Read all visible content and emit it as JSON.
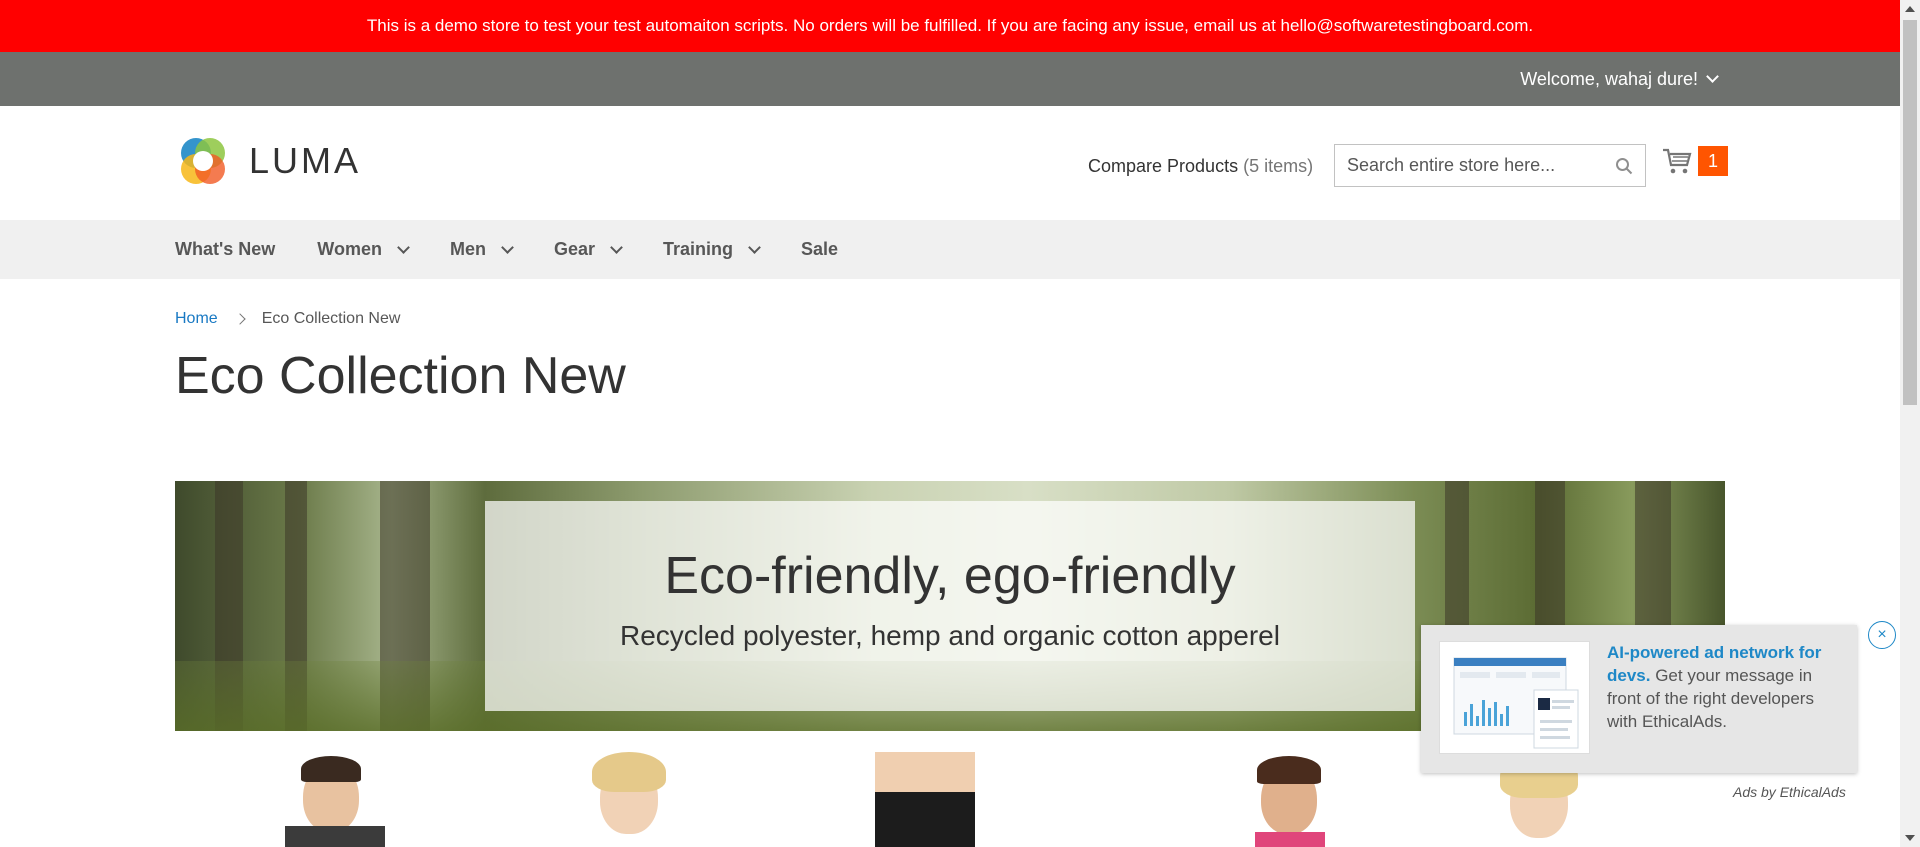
{
  "notice": {
    "text": "This is a demo store to test your test automaiton scripts. No orders will be fulfilled. If you are facing any issue, email us at hello@softwaretestingboard.com."
  },
  "header": {
    "welcome": "Welcome, wahaj dure!",
    "logo_text": "LUMA",
    "compare_label": "Compare Products",
    "compare_count": "(5 items)",
    "search_placeholder": "Search entire store here...",
    "cart_count": "1"
  },
  "nav": {
    "items": [
      {
        "label": "What's New",
        "dropdown": false
      },
      {
        "label": "Women",
        "dropdown": true
      },
      {
        "label": "Men",
        "dropdown": true
      },
      {
        "label": "Gear",
        "dropdown": true
      },
      {
        "label": "Training",
        "dropdown": true
      },
      {
        "label": "Sale",
        "dropdown": false
      }
    ]
  },
  "breadcrumbs": {
    "home": "Home",
    "current": "Eco Collection New"
  },
  "page": {
    "title": "Eco Collection New"
  },
  "banner": {
    "title": "Eco-friendly, ego-friendly",
    "subtitle": "Recycled polyester, hemp and organic cotton apperel"
  },
  "ad": {
    "headline": "AI-powered ad network for devs.",
    "body": " Get your message in front of the right developers with EthicalAds.",
    "close": "×",
    "attribution": "Ads by EthicalAds"
  },
  "colors": {
    "notice_bg": "#ff0000",
    "panel_bg": "#6e716e",
    "cart_counter": "#ff5501",
    "link": "#1979c3",
    "ad_accent": "#1e88c7"
  }
}
